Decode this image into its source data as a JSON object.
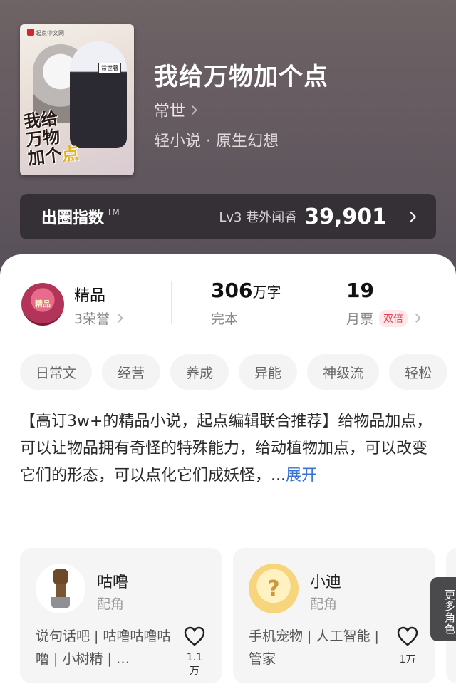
{
  "book": {
    "title": "我给万物加个点",
    "author": "常世",
    "genre": "轻小说 · 原生幻想",
    "cover": {
      "publisher": "起点中文网",
      "author_tag": "常世著",
      "title_line1": "我给",
      "title_line2": "万物",
      "title_line3": "加个",
      "title_highlight": "点"
    }
  },
  "index_bar": {
    "label": "出圈指数",
    "tm": "TM",
    "level": "Lv3 巷外闻香",
    "value": "39,901"
  },
  "stats": {
    "quality": {
      "badge_text": "精品",
      "title": "精品",
      "honors": "3荣誉"
    },
    "words": {
      "number": "306",
      "unit": "万字",
      "status": "完本"
    },
    "tickets": {
      "number": "19",
      "label": "月票",
      "tag": "双倍"
    }
  },
  "tags": [
    "日常文",
    "经营",
    "养成",
    "异能",
    "神级流",
    "轻松"
  ],
  "description": {
    "text": "【高订3w+的精品小说，起点编辑联合推荐】给物品加点，可以让物品拥有奇怪的特殊能力，给动植物加点，可以改变它们的形态，可以点化它们成妖怪，...",
    "expand": "展开"
  },
  "characters": [
    {
      "name": "咕噜",
      "role": "配角",
      "tags": "说句话吧 | 咕噜咕噜咕噜 | 小树精 | …",
      "likes": "1.1万",
      "avatar": "groot-avatar"
    },
    {
      "name": "小迪",
      "role": "配角",
      "tags": "手机宠物 | 人工智能 | 管家",
      "likes": "1万",
      "avatar": "unknown-avatar"
    }
  ],
  "more_roles": "更多角色",
  "colors": {
    "accent_link": "#3a73d6",
    "double_tag": "#e0435a",
    "background_top": "#6e6365"
  }
}
